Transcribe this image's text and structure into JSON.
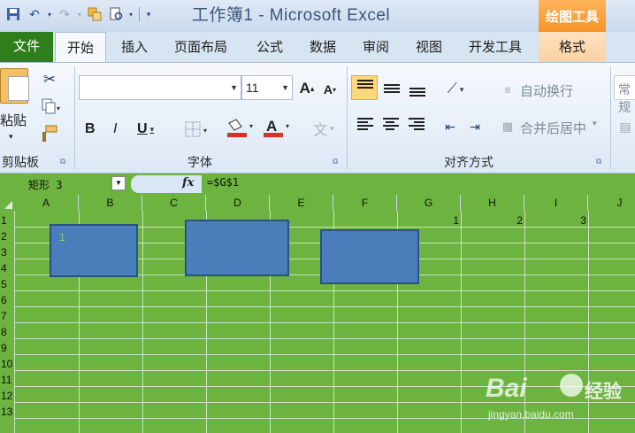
{
  "window": {
    "title": "工作簿1 - Microsoft Excel",
    "contextual_tab_header": "绘图工具"
  },
  "tabs": [
    {
      "label": "文件"
    },
    {
      "label": "开始"
    },
    {
      "label": "插入"
    },
    {
      "label": "页面布局"
    },
    {
      "label": "公式"
    },
    {
      "label": "数据"
    },
    {
      "label": "审阅"
    },
    {
      "label": "视图"
    },
    {
      "label": "开发工具"
    },
    {
      "label": "格式"
    }
  ],
  "ribbon": {
    "clipboard": {
      "paste_label": "粘贴",
      "group_label": "剪贴板"
    },
    "font": {
      "font_name": "",
      "font_size": "11",
      "group_label": "字体",
      "bold": "B",
      "italic": "I",
      "underline": "U"
    },
    "alignment": {
      "wrap_text": "自动换行",
      "merge_center": "合并后居中",
      "group_label": "对齐方式"
    },
    "number": {
      "format_preview": "常规"
    }
  },
  "formula_bar": {
    "name_box": "矩形 3",
    "fx": "fx",
    "formula": "=$G$1"
  },
  "sheet": {
    "columns": [
      "A",
      "B",
      "C",
      "D",
      "E",
      "F",
      "G",
      "H",
      "I",
      "J"
    ],
    "rows": [
      "1",
      "2",
      "3",
      "4",
      "5",
      "6",
      "7",
      "8",
      "9",
      "10",
      "11",
      "12",
      "13"
    ],
    "cells": [
      {
        "ref": "G1",
        "value": "1"
      },
      {
        "ref": "H1",
        "value": "2"
      },
      {
        "ref": "I1",
        "value": "3"
      }
    ],
    "shapes": [
      {
        "name": "矩形 1",
        "text": "1"
      },
      {
        "name": "矩形 2",
        "text": ""
      },
      {
        "name": "矩形 3",
        "text": ""
      }
    ],
    "background_color": "#6db33f",
    "shape_color": "#4a7ebb"
  },
  "watermark": {
    "brand": "Bai",
    "brand2": "经验",
    "url": "jingyan.baidu.com"
  }
}
